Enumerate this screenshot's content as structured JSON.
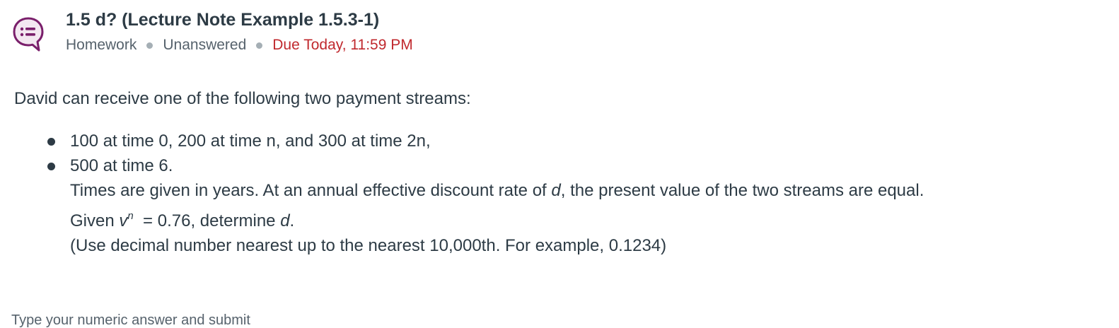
{
  "question": {
    "title": "1.5 d? (Lecture Note Example 1.5.3-1)",
    "type": "Homework",
    "status": "Unanswered",
    "due": "Due Today, 11:59 PM",
    "icon": "question-bubble-icon",
    "accent_color": "#7a1f6b",
    "due_color": "#c0292e"
  },
  "body": {
    "intro": "David can receive one of the following two payment streams:",
    "streams": [
      "100 at time 0,  200 at time  n, and 300 at time  2n,",
      "500 at time 6."
    ],
    "times_sentence_a": "Times are given in years. At an annual effective discount rate of ",
    "var_d": "d",
    "times_sentence_b": ", the present value of the two streams are equal.",
    "given_prefix": "Given ",
    "var_v": "v",
    "var_n": "n",
    "given_mid": "  = 0.76, determine ",
    "given_end": ".",
    "rounding_note": "(Use decimal number nearest up to the nearest 10,000th. For example, 0.1234)"
  },
  "answer": {
    "label": "Type your numeric answer and submit"
  }
}
